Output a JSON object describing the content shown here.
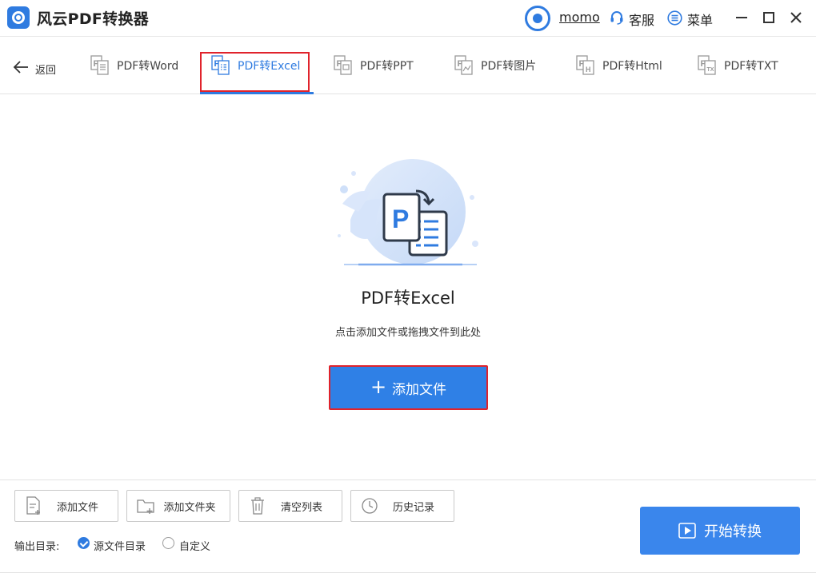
{
  "app": {
    "title": "风云PDF转换器"
  },
  "header": {
    "username": "momo",
    "service_label": "客服",
    "menu_label": "菜单"
  },
  "nav": {
    "back_label": "返回",
    "tabs": [
      {
        "label": "PDF转Word",
        "active": false
      },
      {
        "label": "PDF转Excel",
        "active": true
      },
      {
        "label": "PDF转PPT",
        "active": false
      },
      {
        "label": "PDF转图片",
        "active": false
      },
      {
        "label": "PDF转Html",
        "active": false
      },
      {
        "label": "PDF转TXT",
        "active": false
      }
    ]
  },
  "dropzone": {
    "title": "PDF转Excel",
    "hint": "点击添加文件或拖拽文件到此处",
    "add_button_label": "添加文件"
  },
  "toolbar": {
    "add_file": "添加文件",
    "add_folder": "添加文件夹",
    "clear_list": "清空列表",
    "history": "历史记录"
  },
  "output": {
    "label": "输出目录:",
    "options": [
      {
        "label": "源文件目录",
        "selected": true
      },
      {
        "label": "自定义",
        "selected": false
      }
    ]
  },
  "start_button_label": "开始转换",
  "colors": {
    "accent": "#2f7be0",
    "highlight_border": "#e0232c"
  }
}
